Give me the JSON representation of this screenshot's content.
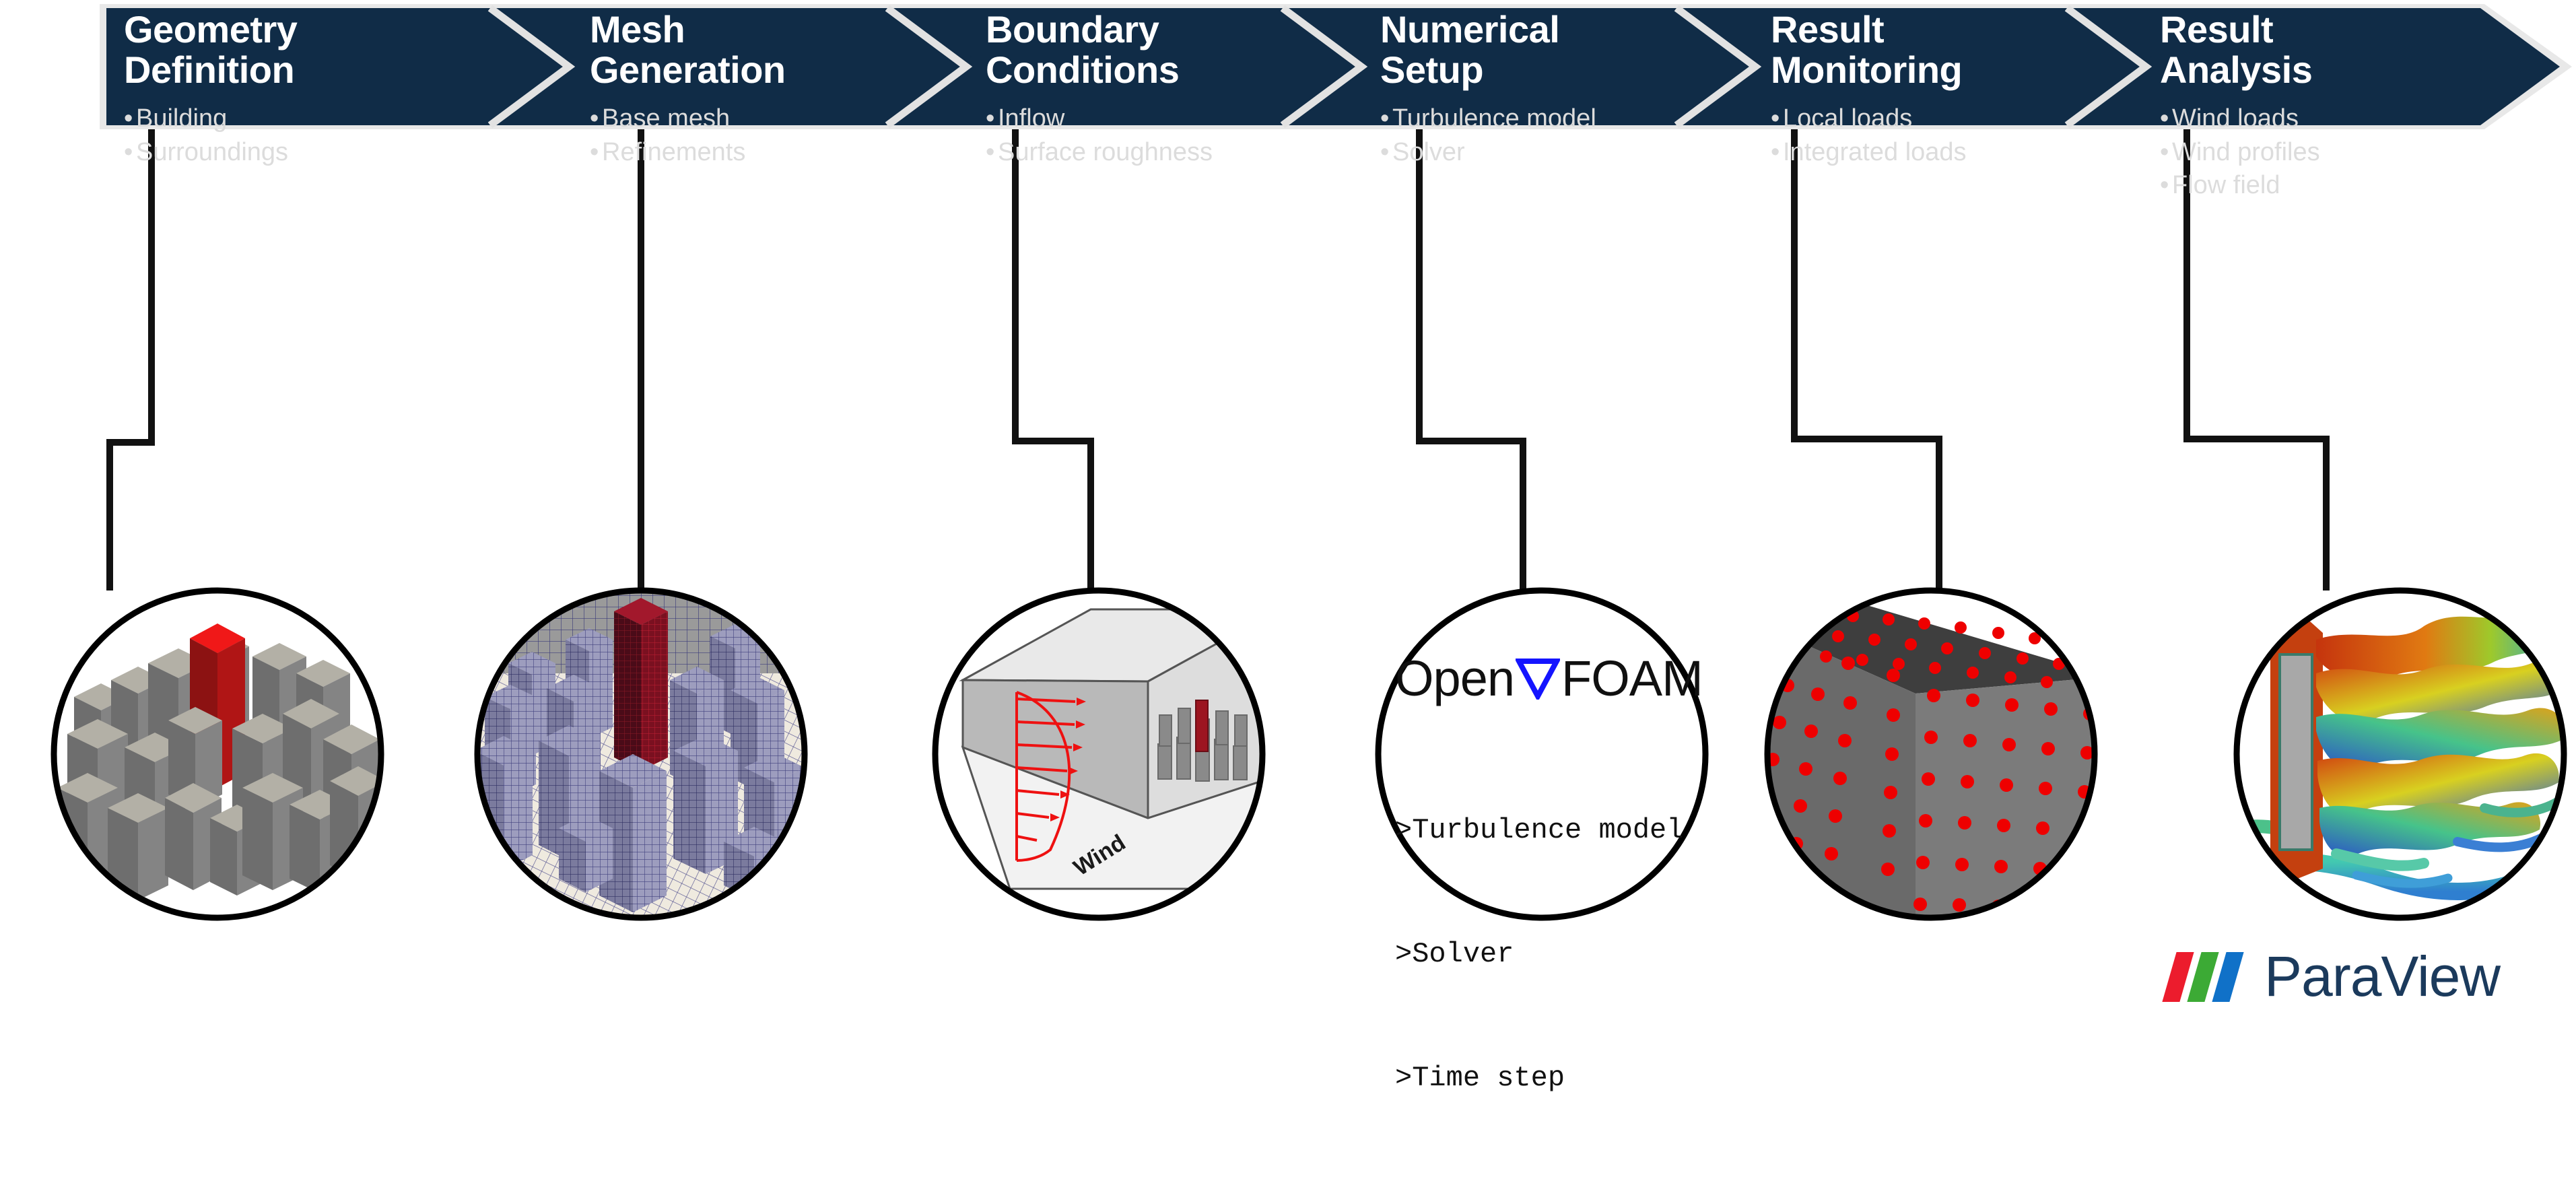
{
  "colors": {
    "banner_navy": "#102c47",
    "banner_edge": "#e6e6e6",
    "page_bg": "#ffffff",
    "bullet_text": "#dcdcdc",
    "title_text": "#ffffff",
    "connector": "#111111",
    "circle_stroke": "#000000",
    "accent_red": "#cc0000",
    "openfoam_triangle_blue": "#1414ff",
    "paraview_red": "#ec1c2d",
    "paraview_green": "#3caa35",
    "paraview_blue": "#1071c8",
    "paraview_text": "#1b3a5c",
    "mesh_purple": "#6b6ba8",
    "building_gray": "#808080"
  },
  "workflow": {
    "steps": [
      {
        "title": "Geometry\nDefinition",
        "bullets": [
          "Building",
          "Surroundings"
        ]
      },
      {
        "title": "Mesh\nGeneration",
        "bullets": [
          "Base mesh",
          "Refinements"
        ]
      },
      {
        "title": "Boundary\nConditions",
        "bullets": [
          "Inflow",
          "Surface roughness"
        ]
      },
      {
        "title": "Numerical\nSetup",
        "bullets": [
          "Turbulence model",
          "Solver"
        ]
      },
      {
        "title": "Result\nMonitoring",
        "bullets": [
          "Local loads",
          "Integrated loads"
        ]
      },
      {
        "title": "Result\nAnalysis",
        "bullets": [
          "Wind loads",
          "Wind profiles",
          "Flow field"
        ]
      }
    ]
  },
  "illustrations": {
    "geometry": {
      "caption": ""
    },
    "mesh": {
      "caption": ""
    },
    "boundary": {
      "wind_label": "Wind"
    },
    "numerical": {
      "logo_part1": "Open",
      "logo_part2": "FOAM",
      "console_lines": [
        ">Turbulence model",
        ">Solver",
        ">Time step"
      ]
    },
    "monitoring": {
      "caption": ""
    },
    "analysis": {
      "caption": ""
    }
  },
  "paraview": {
    "wordmark": "ParaView"
  }
}
